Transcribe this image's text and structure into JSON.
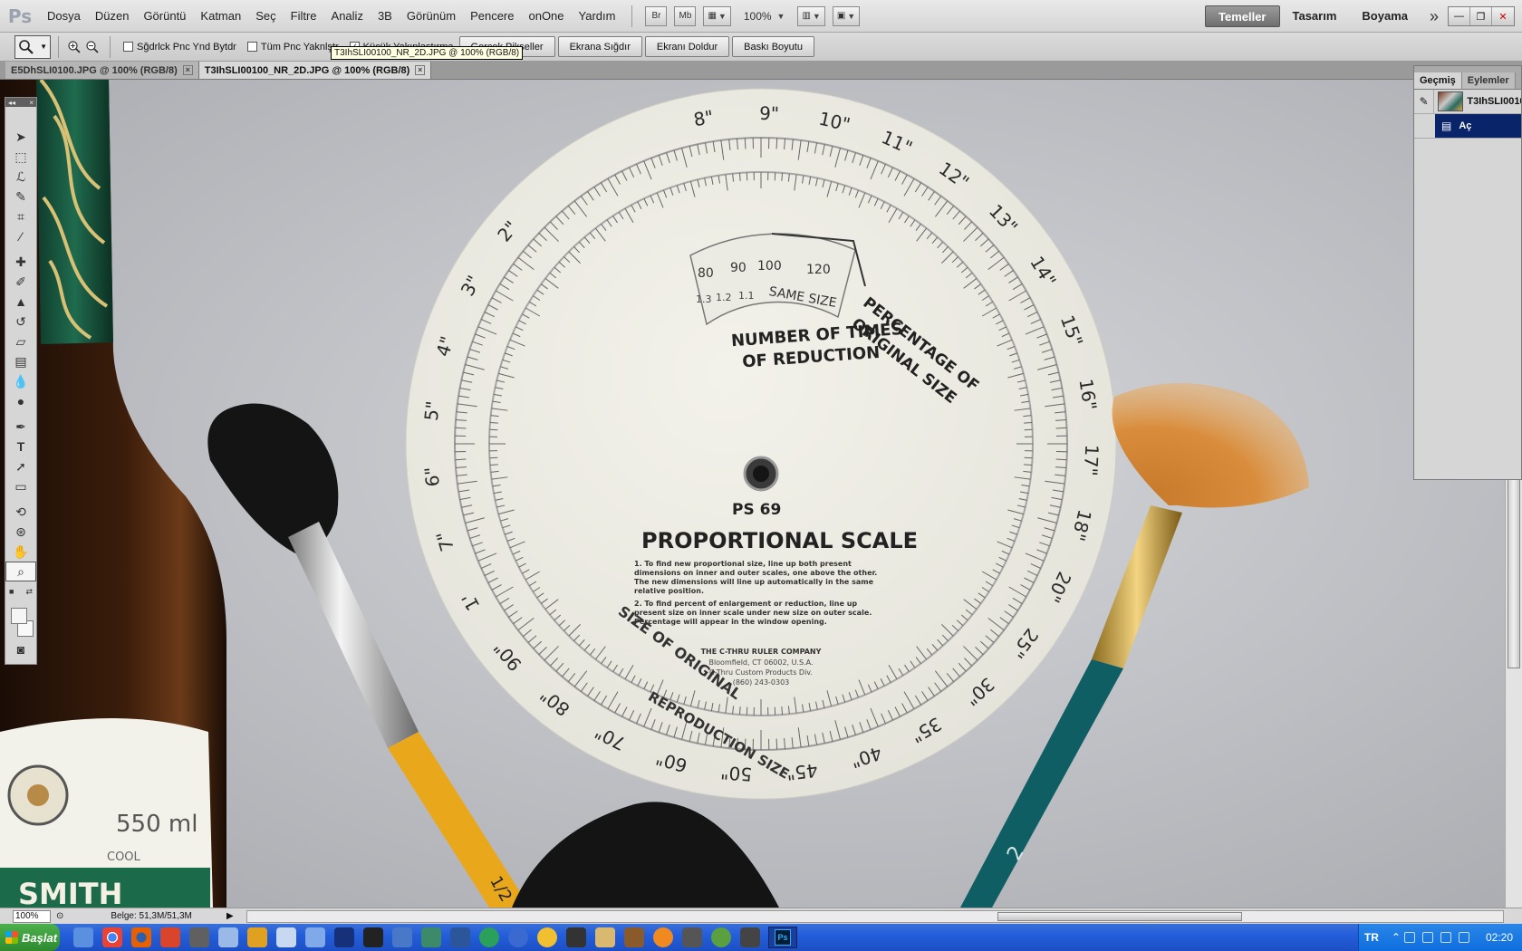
{
  "menubar": {
    "app_logo": "Ps",
    "items": [
      "Dosya",
      "Düzen",
      "Görüntü",
      "Katman",
      "Seç",
      "Filtre",
      "Analiz",
      "3B",
      "Görünüm",
      "Pencere",
      "onOne",
      "Yardım"
    ],
    "bridge_label": "Br",
    "minibridge_label": "Mb",
    "zoom_value": "100%",
    "workspaces": [
      "Temeller",
      "Tasarım",
      "Boyama"
    ],
    "active_workspace": "Temeller"
  },
  "options": {
    "resize_windows_label": "Sğdrlck Pnc Ynd Bytdr",
    "all_windows_label": "Tüm Pnc Yaknlştr",
    "scrubby_zoom_label": "Küçük Yakınlaştırma",
    "actual_pixels_label": "Gerçek Pikseller",
    "fit_screen_label": "Ekrana Sığdır",
    "fill_screen_label": "Ekranı Doldur",
    "print_size_label": "Baskı Boyutu",
    "tooltip": "T3IhSLI00100_NR_2D.JPG @ 100% (RGB/8)"
  },
  "tabs": [
    {
      "label": "E5DhSLI0100.JPG @ 100% (RGB/8)",
      "active": false
    },
    {
      "label": "T3IhSLI00100_NR_2D.JPG @ 100% (RGB/8)",
      "active": true
    }
  ],
  "history_panel": {
    "tabs": [
      "Geçmiş",
      "Eylemler"
    ],
    "snapshot_label": "T3IhSLI0010",
    "step_label": "Aç"
  },
  "photo": {
    "scale_title": "PS 69",
    "scale_heading": "PROPORTIONAL SCALE",
    "instruction_1": "1. To find new proportional size, line up both present dimensions on inner and outer scales, one above the other. The new dimensions will line up automatically in the same relative position.",
    "instruction_2": "2. To find percent of enlargement or reduction, line up present size on inner scale under new size on outer scale. Percentage will appear in the window opening.",
    "company": "THE C-THRU RULER COMPANY",
    "address": "Bloomfield, CT 06002, U.S.A.",
    "division": "C-Thru Custom Products Div.",
    "phone": "(860) 243-0303",
    "window_label_1": "NUMBER OF TIMES",
    "window_label_2": "OF REDUCTION",
    "percentage_label_1": "PERCENTAGE OF",
    "percentage_label_2": "ORIGINAL SIZE",
    "same_size": "SAME SIZE",
    "size_of_original": "SIZE OF ORIGINAL",
    "reproduction_size": "REPRODUCTION SIZE",
    "window_ticks": [
      "80",
      "90",
      "100",
      "120"
    ],
    "window_factors": [
      "1.3",
      "1.2",
      "1.1"
    ],
    "outer_numbers": [
      "8\"",
      "9\"",
      "10\"",
      "11\"",
      "12\"",
      "13\"",
      "14\"",
      "15\"",
      "16\"",
      "17\"",
      "18\"",
      "20\"",
      "25\"",
      "30\"",
      "35\"",
      "40\"",
      "45\"",
      "50\"",
      "60\"",
      "70\"",
      "80\"",
      "90\"",
      "1'",
      "7\"",
      "6\"",
      "5\"",
      "4\"",
      "3\"",
      "2\""
    ],
    "bottle_volume": "550 ml",
    "bottle_cool": "COOL",
    "bottle_brand": "SMITH",
    "brush_size": "1/2",
    "fan_brush_number": "2"
  },
  "status": {
    "zoom": "100%",
    "doc_info": "Belge: 51,3M/51,3M"
  },
  "taskbar": {
    "start_label": "Başlat",
    "language": "TR",
    "clock": "02:20"
  },
  "colors": {
    "menubar_bg": "#dcdcdc",
    "canvas_bg": "#bfc1c5",
    "selection_blue": "#0a246a",
    "taskbar_blue": "#245edb",
    "start_green": "#2e8b2e"
  }
}
